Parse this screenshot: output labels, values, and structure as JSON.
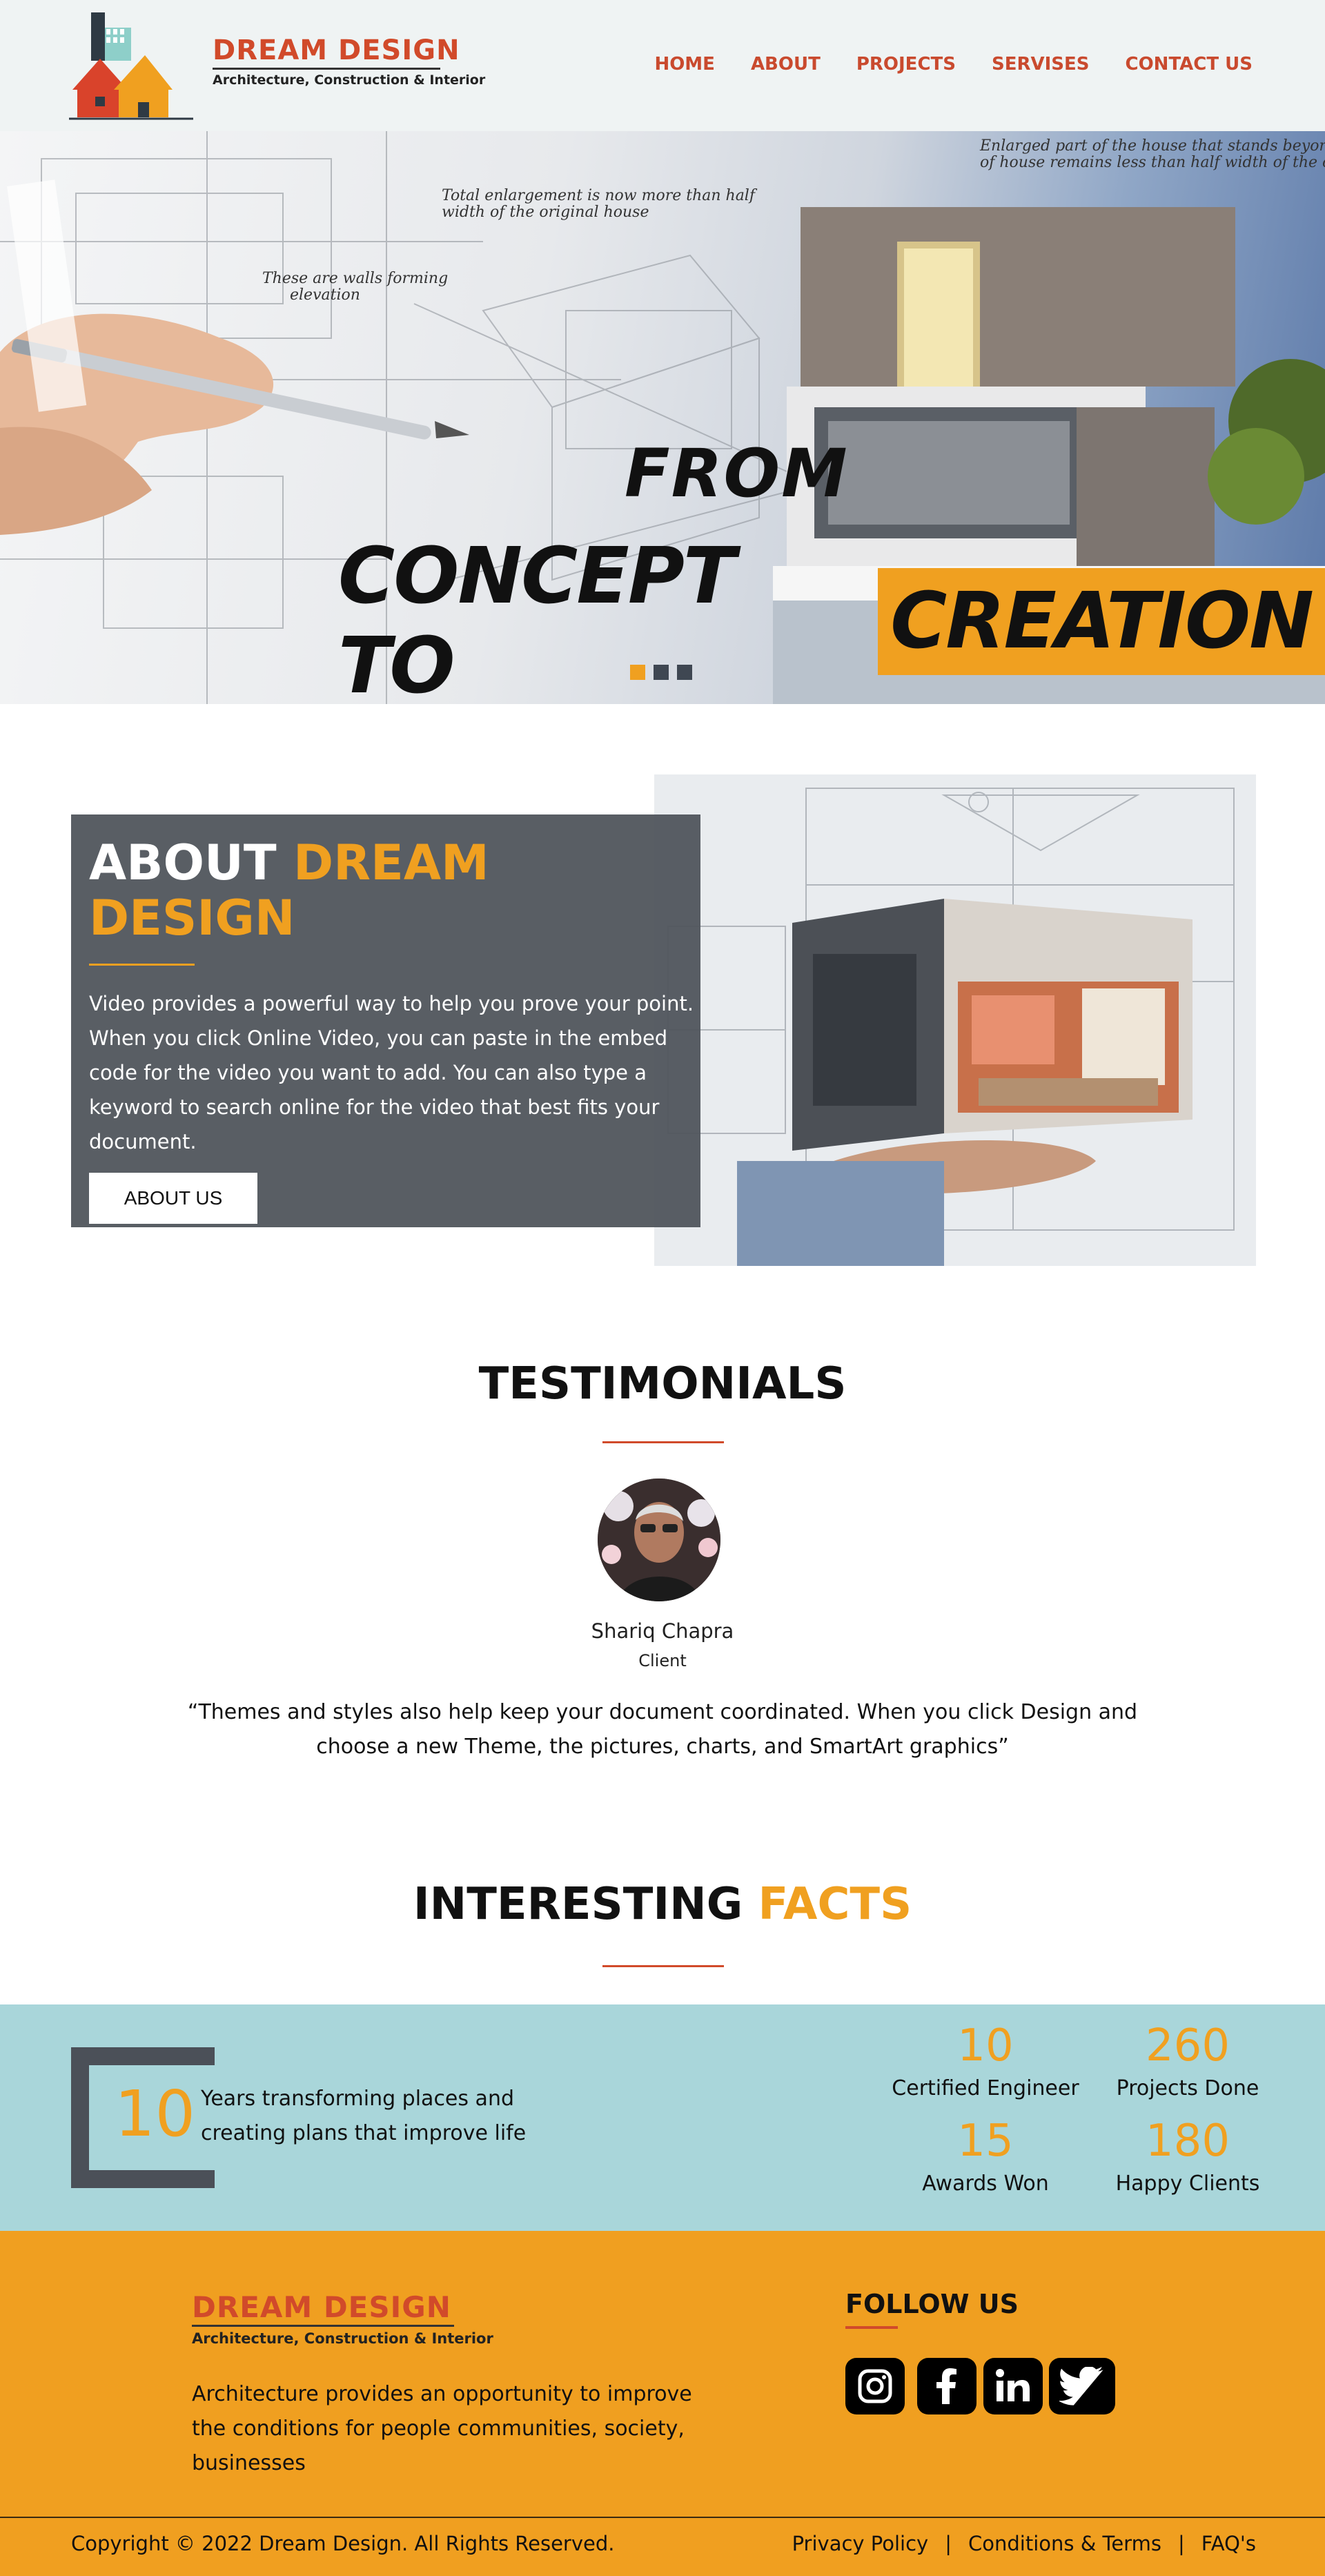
{
  "brand": {
    "name": "DREAM DESIGN",
    "tagline": "Architecture, Construction & Interior"
  },
  "nav": {
    "items": [
      "HOME",
      "ABOUT",
      "PROJECTS",
      "SERVISES",
      "CONTACT US"
    ]
  },
  "hero": {
    "line1": "FROM",
    "line2a": "CONCEPT TO",
    "line2b": "CREATION",
    "sketch_note1": "Enlarged part of the house that stands beyond side wall of house remains less than half width of the original house",
    "sketch_note2": "Total enlargement is now more than half width of the original house",
    "sketch_note3": "These are walls forming elevation",
    "slides": 3,
    "active_slide": 1
  },
  "about": {
    "title_prefix": "ABOUT",
    "title_accent": "DREAM DESIGN",
    "text": "Video provides a powerful way to help you prove your point. When you click Online Video, you can paste in the embed code for the video you want to add. You can also type a keyword to search online for the video that best fits your document.",
    "button": "ABOUT US"
  },
  "testimonials": {
    "title": "TESTIMONIALS",
    "name": "Shariq Chapra",
    "role": "Client",
    "quote": "“Themes and styles also help keep your document coordinated. When you click Design and choose a new Theme, the pictures, charts, and SmartArt graphics”"
  },
  "facts": {
    "title_prefix": "INTERESTING",
    "title_accent": "FACTS",
    "years_value": "10",
    "years_text": "Years transforming places and creating plans that improve life",
    "stats": [
      {
        "value": "10",
        "label": "Certified Engineer"
      },
      {
        "value": "260",
        "label": "Projects Done"
      },
      {
        "value": "15",
        "label": "Awards Won"
      },
      {
        "value": "180",
        "label": "Happy Clients"
      }
    ]
  },
  "footer": {
    "about": "Architecture provides an opportunity to improve the conditions for people communities, society, businesses",
    "follow_title": "FOLLOW US",
    "social": [
      "instagram-icon",
      "facebook-icon",
      "linkedin-icon",
      "twitter-icon"
    ],
    "copyright": "Copyright © 2022 Dream Design. All Rights Reserved.",
    "links": [
      "Privacy Policy",
      "Conditions & Terms",
      "FAQ's"
    ],
    "separator": "|"
  },
  "colors": {
    "accent": "#f0a020",
    "brand_red": "#d14a2a",
    "about_panel": "#50555c",
    "facts_band": "#a9d6da",
    "footer": "#f09f20"
  }
}
